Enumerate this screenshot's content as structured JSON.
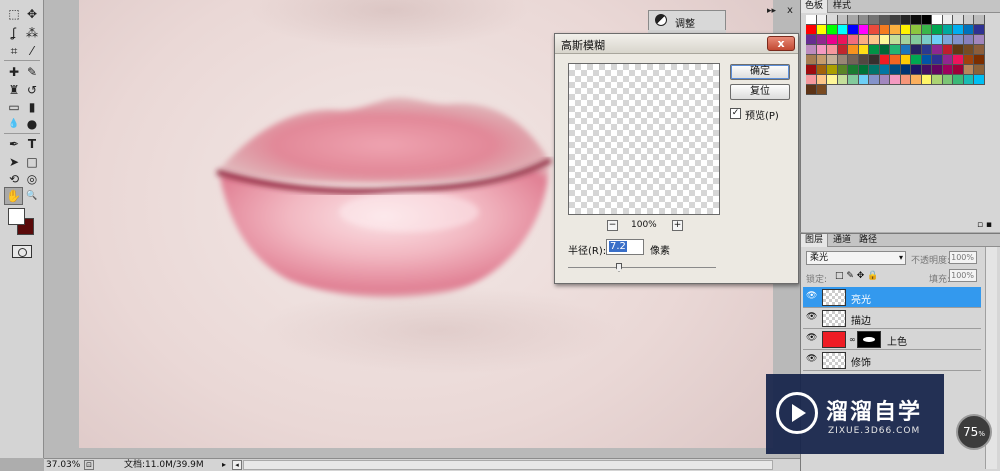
{
  "toolbox": {
    "tools": [
      {
        "name": "marquee-tool-icon",
        "glyph": "⬚"
      },
      {
        "name": "move-tool-icon",
        "glyph": "✥"
      },
      {
        "name": "lasso-tool-icon",
        "glyph": "ʆ"
      },
      {
        "name": "magic-wand-icon",
        "glyph": "⁂"
      },
      {
        "name": "crop-tool-icon",
        "glyph": "⌗"
      },
      {
        "name": "eyedropper-icon",
        "glyph": "⁄"
      },
      {
        "name": "healing-brush-icon",
        "glyph": "✚"
      },
      {
        "name": "brush-tool-icon",
        "glyph": "✎"
      },
      {
        "name": "clone-stamp-icon",
        "glyph": "♜"
      },
      {
        "name": "history-brush-icon",
        "glyph": "↺"
      },
      {
        "name": "eraser-tool-icon",
        "glyph": "▭"
      },
      {
        "name": "gradient-tool-icon",
        "glyph": "▮"
      },
      {
        "name": "blur-tool-icon",
        "glyph": "💧"
      },
      {
        "name": "dodge-tool-icon",
        "glyph": "●"
      },
      {
        "name": "pen-tool-icon",
        "glyph": "✒"
      },
      {
        "name": "type-tool-icon",
        "glyph": "T"
      },
      {
        "name": "path-select-icon",
        "glyph": "➤"
      },
      {
        "name": "shape-tool-icon",
        "glyph": "□"
      },
      {
        "name": "3d-rotate-icon",
        "glyph": "⟲"
      },
      {
        "name": "3d-orbit-icon",
        "glyph": "◎"
      },
      {
        "name": "hand-tool-icon",
        "glyph": "✋"
      },
      {
        "name": "zoom-tool-icon",
        "glyph": "🔍"
      }
    ],
    "foreground_color": "#ffffff",
    "background_color": "#5a0a0a"
  },
  "dialog": {
    "title": "高斯模糊",
    "close_glyph": "x",
    "ok_label": "确定",
    "reset_label": "复位",
    "preview_checked": true,
    "preview_check_glyph": "✓",
    "preview_label": "预览(P)",
    "zoom_out_glyph": "−",
    "zoom_in_glyph": "+",
    "zoom_level": "100%",
    "radius_label": "半径(R):",
    "radius_value": "7.2",
    "radius_unit": "像素"
  },
  "adjust_panel": {
    "tab_label": "调整",
    "collapse_glyph": "▸▸",
    "close_glyph": "x"
  },
  "swatches_panel": {
    "tabs": [
      "色板",
      "样式"
    ],
    "colors": [
      "#ffffff",
      "#f2f2f2",
      "#d9d9d9",
      "#bfbfbf",
      "#a6a6a6",
      "#8c8c8c",
      "#737373",
      "#595959",
      "#404040",
      "#262626",
      "#0d0d0d",
      "#000000",
      "#ffffff",
      "#eeeeee",
      "#dddddd",
      "#cccccc",
      "#bbbbbb",
      "#ff0000",
      "#ffff00",
      "#00ff00",
      "#00ffff",
      "#0000ff",
      "#ff00ff",
      "#e94b3c",
      "#f47b20",
      "#fbb040",
      "#fff200",
      "#8dc63f",
      "#39b54a",
      "#00a651",
      "#00a99d",
      "#00aeef",
      "#0072bc",
      "#2e3192",
      "#662d91",
      "#92278f",
      "#ec008c",
      "#ed145b",
      "#f26d7d",
      "#f9ad81",
      "#fdc68a",
      "#fff79a",
      "#c4df9b",
      "#a3d39c",
      "#82ca9c",
      "#7accc8",
      "#6dcff6",
      "#7da7d9",
      "#8393ca",
      "#8781bd",
      "#a186be",
      "#bd8cbf",
      "#f49ac2",
      "#f6989d",
      "#c1272d",
      "#f7931e",
      "#ffde17",
      "#009245",
      "#006837",
      "#22b573",
      "#1b75bc",
      "#262262",
      "#2b3990",
      "#8e278f",
      "#be1e2d",
      "#603913",
      "#754c24",
      "#8b5e3c",
      "#a67c52",
      "#c69c6d",
      "#c7b299",
      "#998675",
      "#736357",
      "#534741",
      "#362f2d",
      "#ee1c24",
      "#f26522",
      "#ffcb05",
      "#00a651",
      "#0054a6",
      "#2e3192",
      "#92278f",
      "#ed145b",
      "#a0410d",
      "#7b2e00",
      "#9e0b0f",
      "#a3620a",
      "#aba000",
      "#598527",
      "#1a7b30",
      "#007236",
      "#00746b",
      "#0076a3",
      "#004b80",
      "#003471",
      "#1b1464",
      "#440e62",
      "#630460",
      "#9e005d",
      "#9e0039",
      "#b8865b",
      "#8c6239",
      "#f5989d",
      "#fdc689",
      "#fff799",
      "#c4df9b",
      "#82ca9c",
      "#6ecff6",
      "#8493ca",
      "#a187be",
      "#f49ac1",
      "#f69679",
      "#fbaf5d",
      "#fff568",
      "#acd373",
      "#7cc576",
      "#3bb878",
      "#1abbb4",
      "#00bff3",
      "#5c3317",
      "#7a4b22"
    ],
    "footer_icons": [
      "new-swatch-icon",
      "delete-swatch-icon"
    ]
  },
  "layers_panel": {
    "tabs": [
      "图层",
      "通道",
      "路径"
    ],
    "blend_mode": "柔光",
    "opacity_label": "不透明度:",
    "opacity_value": "100%",
    "lock_label": "锁定:",
    "lock_glyphs": "□ ✎ ✥ 🔒",
    "fill_label": "填充:",
    "fill_value": "100%",
    "layers": [
      {
        "name": "亮光",
        "selected": true,
        "thumb": "checker",
        "has_mask": false
      },
      {
        "name": "描边",
        "selected": false,
        "thumb": "checker",
        "has_mask": false
      },
      {
        "name": "上色",
        "selected": false,
        "thumb": "red",
        "has_mask": true
      },
      {
        "name": "修饰",
        "selected": false,
        "thumb": "checker",
        "has_mask": false
      }
    ]
  },
  "status_bar": {
    "zoom": "37.03%",
    "doc_info": "文档:11.0M/39.9M",
    "arrow_glyph": "▸",
    "scroll_left_glyph": "◂",
    "nav_glyph": "⊡"
  },
  "watermark": {
    "title": "溜溜自学",
    "url": "ZIXUE.3D66.COM"
  },
  "zoom_badge": {
    "value": "75",
    "unit": "%"
  }
}
